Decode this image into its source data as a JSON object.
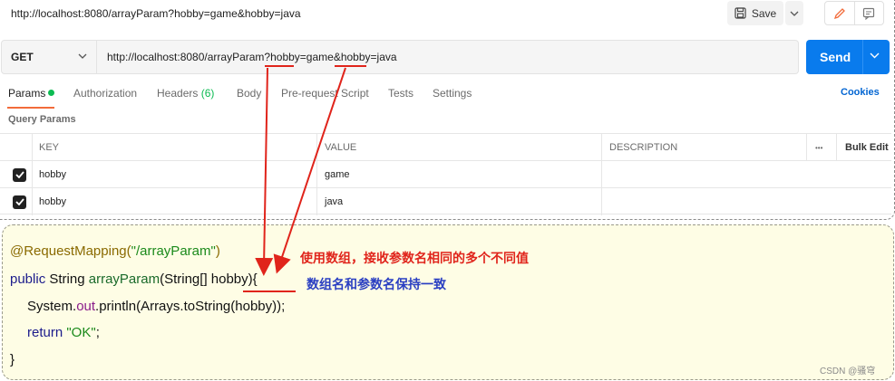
{
  "request": {
    "title": "http://localhost:8080/arrayParam?hobby=game&hobby=java",
    "save_label": "Save",
    "method": "GET",
    "url": "http://localhost:8080/arrayParam?hobby=game&hobby=java",
    "send_label": "Send"
  },
  "tabs": [
    {
      "label": "Params",
      "active": true
    },
    {
      "label": "Authorization"
    },
    {
      "label": "Headers",
      "count": "(6)"
    },
    {
      "label": "Body"
    },
    {
      "label": "Pre-request Script"
    },
    {
      "label": "Tests"
    },
    {
      "label": "Settings"
    }
  ],
  "cookies_label": "Cookies",
  "query_params": {
    "title": "Query Params",
    "headers": {
      "key": "KEY",
      "value": "VALUE",
      "description": "DESCRIPTION",
      "more": "•••",
      "bulk_edit": "Bulk Edit"
    },
    "rows": [
      {
        "checked": true,
        "key": "hobby",
        "value": "game",
        "description": ""
      },
      {
        "checked": true,
        "key": "hobby",
        "value": "java",
        "description": ""
      }
    ]
  },
  "code": {
    "line1_anno": "@RequestMapping(",
    "line1_str": "\"/arrayParam\"",
    "line1_end": ")",
    "line2_public": "public",
    "line2_type": " String ",
    "line2_name": "arrayParam",
    "line2_args": "(String[] ",
    "line2_param": "hobby",
    "line2_end": "){",
    "line3_a": "System.",
    "line3_b": "out",
    "line3_c": ".println(Arrays.toString(hobby));",
    "line4_return": "return",
    "line4_str": " \"OK\"",
    "line4_end": ";",
    "line5": "}"
  },
  "annotations": {
    "red_note": "使用数组，接收参数名相同的多个不同值",
    "blue_note": "数组名和参数名保持一致"
  },
  "watermark": "CSDN @骚穹",
  "colors": {
    "send": "#097bed",
    "active_tab": "#f26b3a",
    "green_dot": "#0cbb52",
    "cookies": "#0265d2",
    "annotation_red": "#e0241b",
    "annotation_blue": "#2a3fc2",
    "code_bg": "#fefde5"
  }
}
